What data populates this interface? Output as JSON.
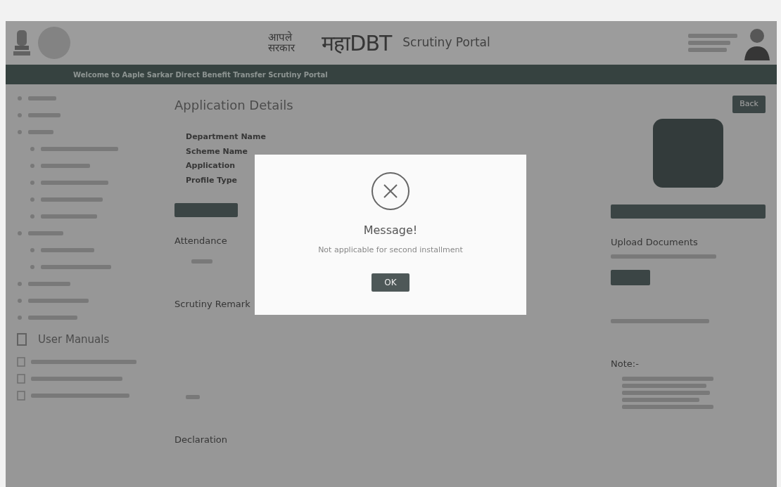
{
  "header": {
    "logo_devanagari": "आपले सरकार",
    "logo_text": "महाDBT",
    "portal_title": "Scrutiny Portal"
  },
  "welcome_banner": "Welcome to Aaple Sarkar Direct Benefit Transfer Scrutiny Portal",
  "sidebar": {
    "manuals_title": "User Manuals"
  },
  "main": {
    "title": "Application Details",
    "back_button": "Back",
    "detail_labels": [
      "Department Name",
      "Scheme Name",
      "Application",
      "Profile Type"
    ],
    "attendance_label": "Attendance",
    "remark_label": "Scrutiny Remark",
    "declaration_label": "Declaration"
  },
  "right_panel": {
    "upload_title": "Upload Documents",
    "note_title": "Note:-"
  },
  "modal": {
    "title": "Message!",
    "message": "Not applicable for second installment",
    "ok_button": "OK"
  }
}
